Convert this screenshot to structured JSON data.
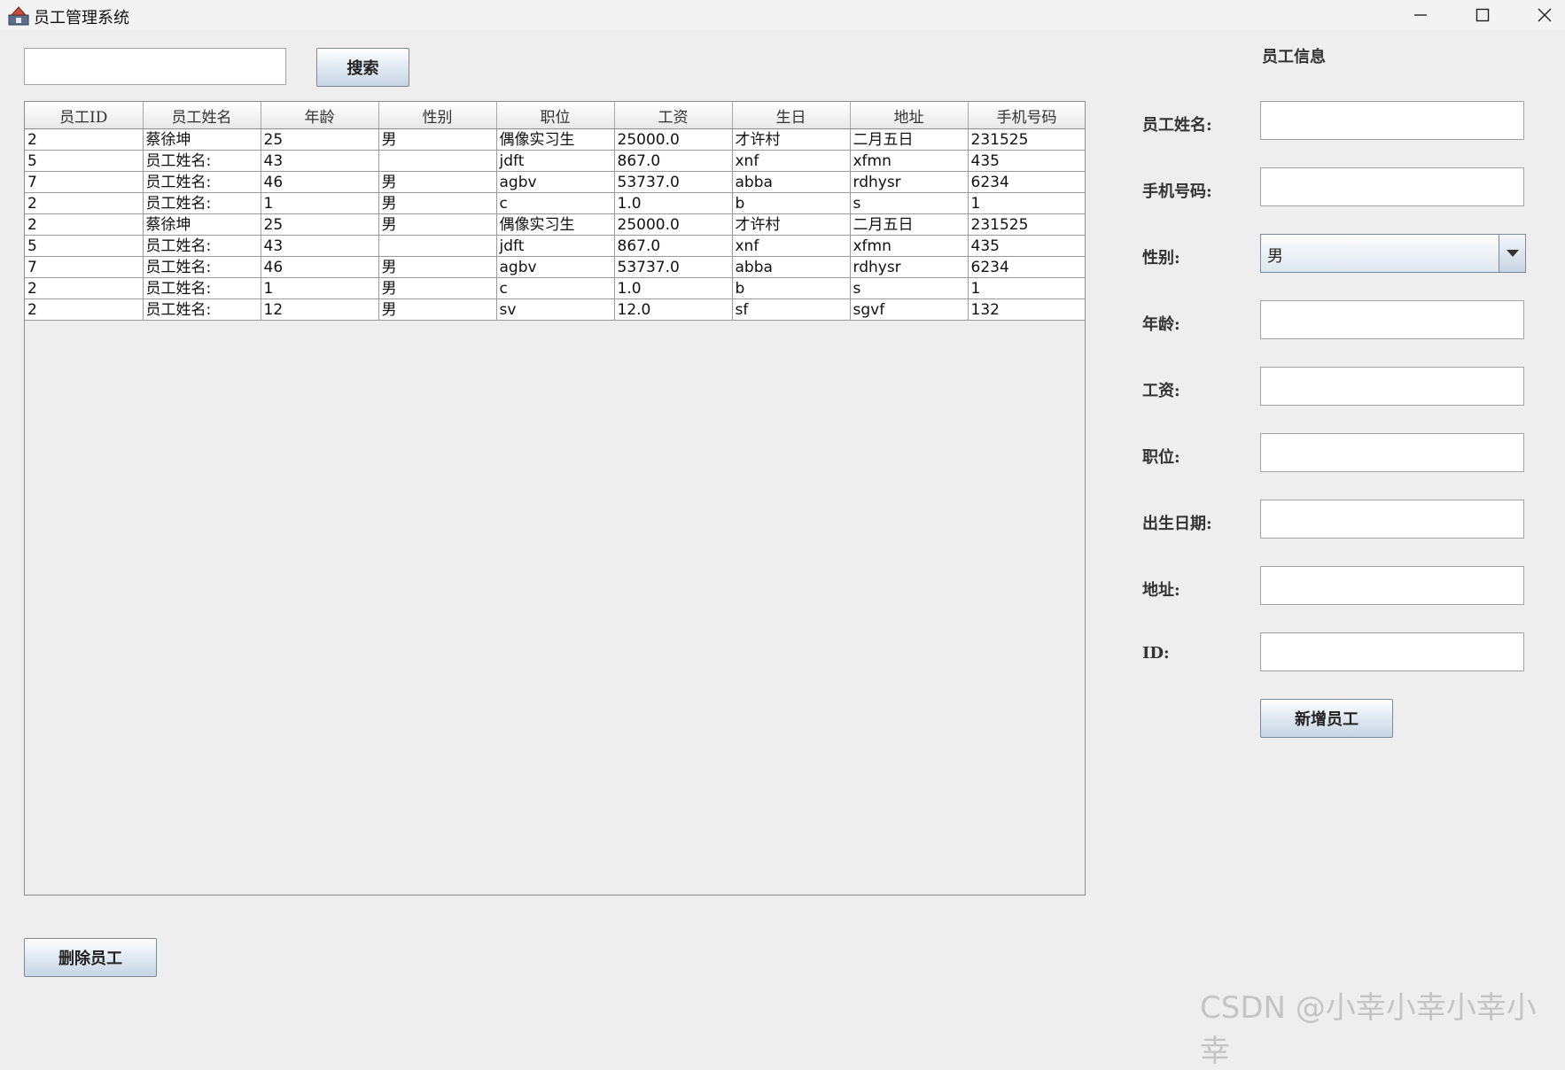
{
  "window": {
    "title": "员工管理系统",
    "app_icon": "java-cup-icon",
    "controls": {
      "minimize": "minimize-icon",
      "maximize": "maximize-icon",
      "close": "close-icon"
    }
  },
  "search": {
    "value": "",
    "button_label": "搜索"
  },
  "table": {
    "columns": [
      "员工ID",
      "员工姓名",
      "年龄",
      "性别",
      "职位",
      "工资",
      "生日",
      "地址",
      "手机号码"
    ],
    "rows": [
      [
        "2",
        "蔡徐坤",
        "25",
        "男",
        "偶像实习生",
        "25000.0",
        "才许村",
        "二月五日",
        "231525"
      ],
      [
        "5",
        "员工姓名:",
        "43",
        "",
        "jdft",
        "867.0",
        "xnf",
        "xfmn",
        "435"
      ],
      [
        "7",
        "员工姓名:",
        "46",
        "男",
        "agbv",
        "53737.0",
        "abba",
        "rdhysr",
        "6234"
      ],
      [
        "2",
        "员工姓名:",
        "1",
        "男",
        "c",
        "1.0",
        "b",
        "s",
        "1"
      ],
      [
        "2",
        "蔡徐坤",
        "25",
        "男",
        "偶像实习生",
        "25000.0",
        "才许村",
        "二月五日",
        "231525"
      ],
      [
        "5",
        "员工姓名:",
        "43",
        "",
        "jdft",
        "867.0",
        "xnf",
        "xfmn",
        "435"
      ],
      [
        "7",
        "员工姓名:",
        "46",
        "男",
        "agbv",
        "53737.0",
        "abba",
        "rdhysr",
        "6234"
      ],
      [
        "2",
        "员工姓名:",
        "1",
        "男",
        "c",
        "1.0",
        "b",
        "s",
        "1"
      ],
      [
        "2",
        "员工姓名:",
        "12",
        "男",
        "sv",
        "12.0",
        "sf",
        "sgvf",
        "132"
      ]
    ]
  },
  "delete_button_label": "删除员工",
  "panel": {
    "title": "员工信息",
    "name_label": "员工姓名:",
    "phone_label": "手机号码:",
    "gender_label": "性别:",
    "gender_value": "男",
    "age_label": "年龄:",
    "salary_label": "工资:",
    "position_label": "职位:",
    "birth_label": "出生日期:",
    "address_label": "地址:",
    "id_label": "ID:",
    "add_button_label": "新增员工"
  },
  "watermark": "CSDN @小幸小幸小幸小幸"
}
